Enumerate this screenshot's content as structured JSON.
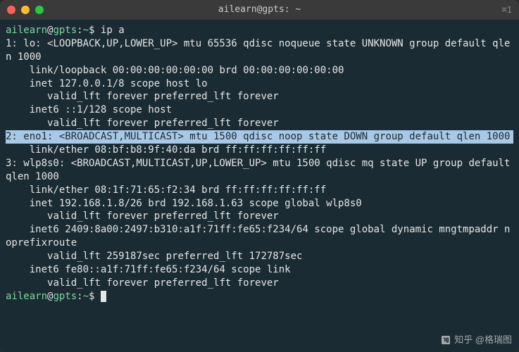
{
  "titlebar": {
    "title": "ailearn@gpts: ~",
    "shortcut": "⌘1"
  },
  "prompt": {
    "user": "ailearn",
    "host": "gpts",
    "path": "~",
    "dollar": "$"
  },
  "command": "ip a",
  "output": {
    "l1": "1: lo: <LOOPBACK,UP,LOWER_UP> mtu 65536 qdisc noqueue state UNKNOWN group default qlen 1000",
    "l2": "    link/loopback 00:00:00:00:00:00 brd 00:00:00:00:00:00",
    "l3": "    inet 127.0.0.1/8 scope host lo",
    "l4": "       valid_lft forever preferred_lft forever",
    "l5": "    inet6 ::1/128 scope host",
    "l6": "       valid_lft forever preferred_lft forever",
    "highlight": "2: eno1: <BROADCAST,MULTICAST> mtu 1500 qdisc noop state DOWN group default qlen 1000",
    "l8": "    link/ether 08:bf:b8:9f:40:da brd ff:ff:ff:ff:ff:ff",
    "l9": "3: wlp8s0: <BROADCAST,MULTICAST,UP,LOWER_UP> mtu 1500 qdisc mq state UP group default qlen 1000",
    "l10": "    link/ether 08:1f:71:65:f2:34 brd ff:ff:ff:ff:ff:ff",
    "l11": "    inet 192.168.1.8/26 brd 192.168.1.63 scope global wlp8s0",
    "l12": "       valid_lft forever preferred_lft forever",
    "l13": "    inet6 2409:8a00:2497:b310:a1f:71ff:fe65:f234/64 scope global dynamic mngtmpaddr noprefixroute",
    "l14": "       valid_lft 259187sec preferred_lft 172787sec",
    "l15": "    inet6 fe80::a1f:71ff:fe65:f234/64 scope link",
    "l16": "       valid_lft forever preferred_lft forever"
  },
  "watermark": "知乎 @格瑞图"
}
